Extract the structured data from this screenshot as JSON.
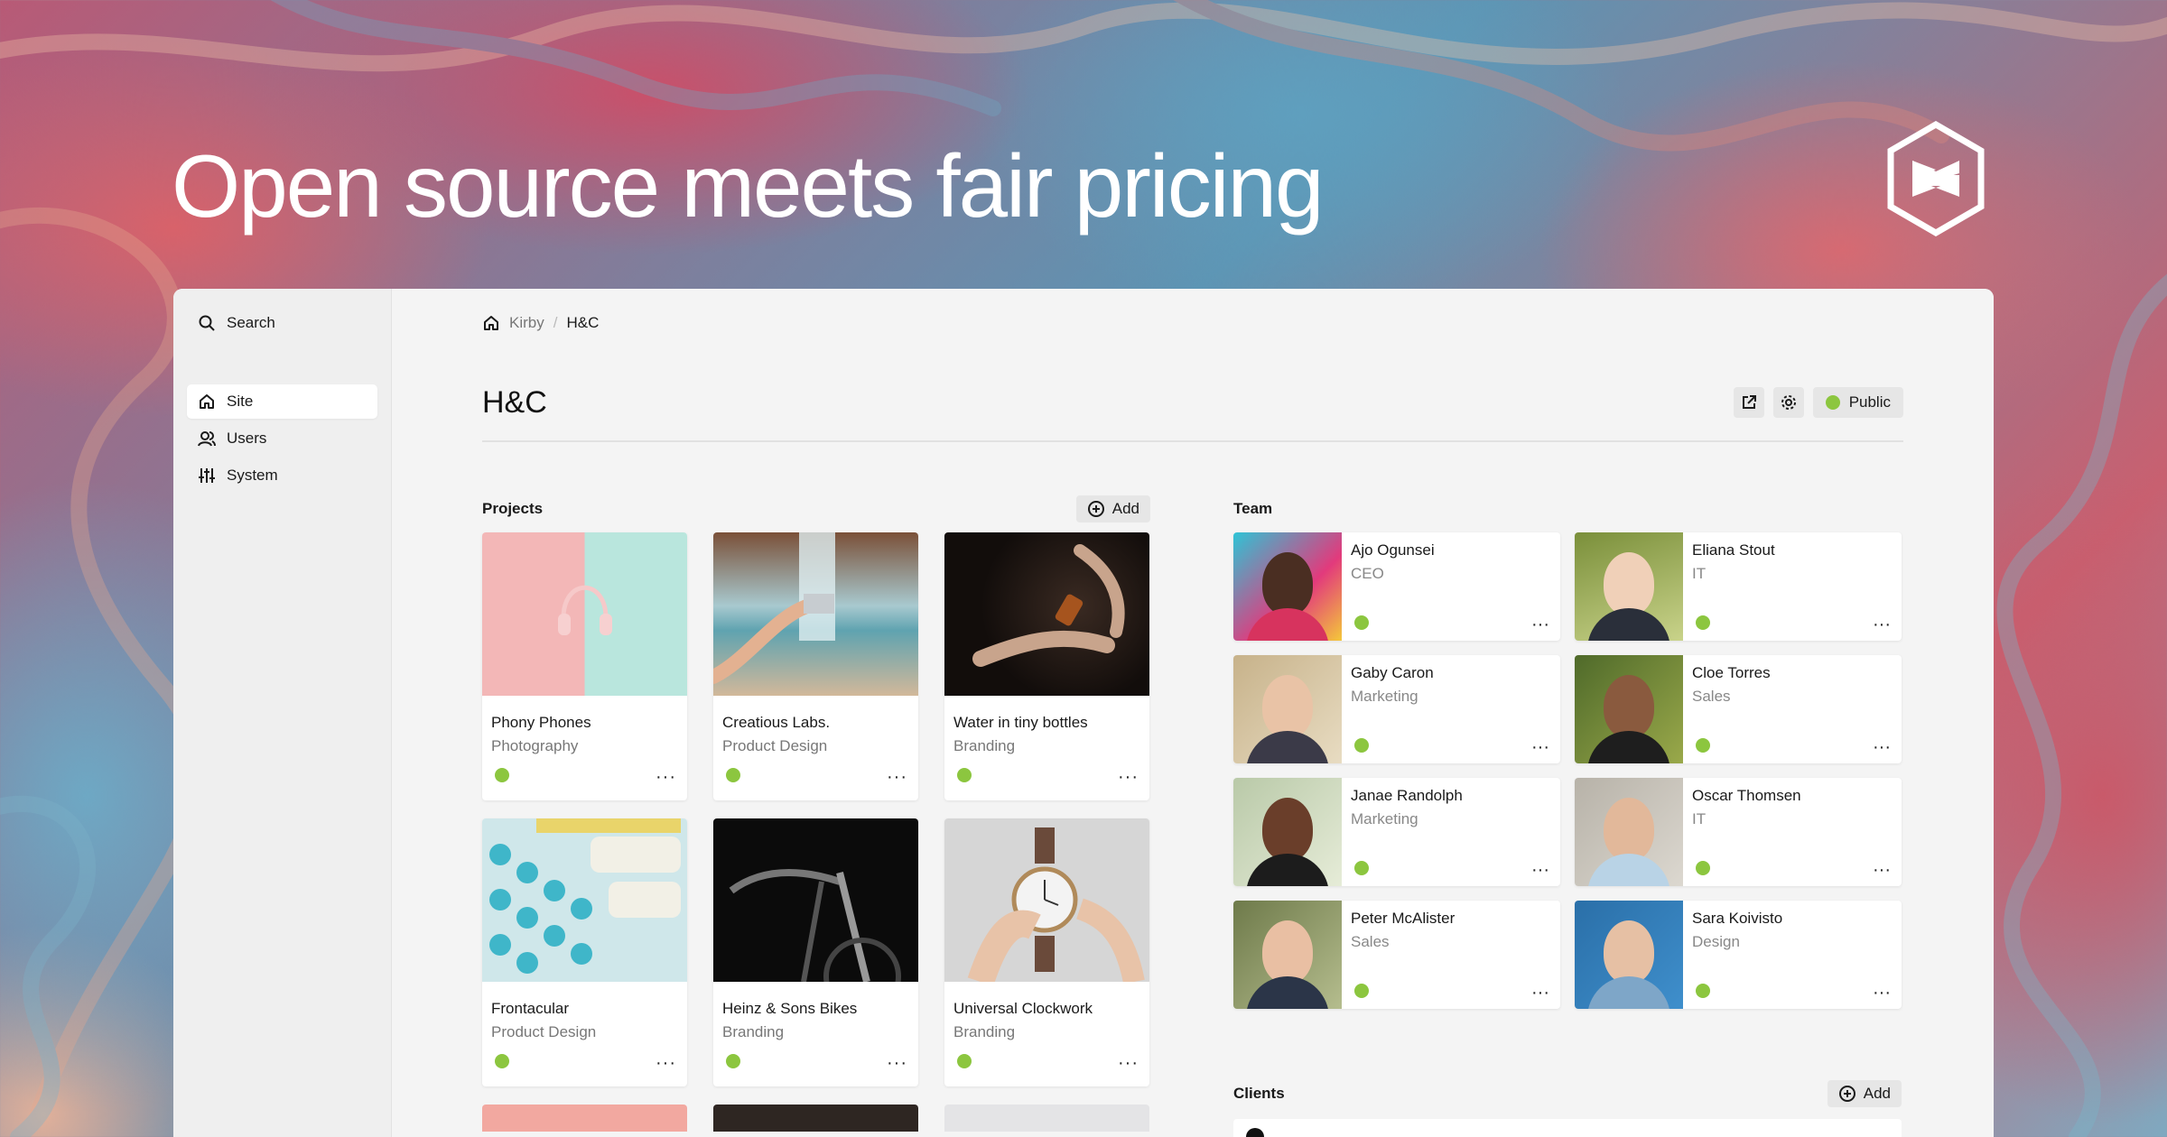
{
  "hero": {
    "title": "Open source meets fair pricing"
  },
  "sidebar": {
    "search_label": "Search",
    "items": [
      {
        "label": "Site",
        "icon": "home-icon",
        "active": true
      },
      {
        "label": "Users",
        "icon": "users-icon",
        "active": false
      },
      {
        "label": "System",
        "icon": "sliders-icon",
        "active": false
      }
    ]
  },
  "breadcrumb": {
    "root": "Kirby",
    "current": "H&C"
  },
  "page": {
    "title": "H&C",
    "status_label": "Public",
    "status_color": "#8cc63f"
  },
  "projects": {
    "title": "Projects",
    "add_label": "Add",
    "items": [
      {
        "title": "Phony Phones",
        "subtitle": "Photography"
      },
      {
        "title": "Creatious Labs.",
        "subtitle": "Product Design"
      },
      {
        "title": "Water in tiny bottles",
        "subtitle": "Branding"
      },
      {
        "title": "Frontacular",
        "subtitle": "Product Design"
      },
      {
        "title": "Heinz & Sons Bikes",
        "subtitle": "Branding"
      },
      {
        "title": "Universal Clockwork",
        "subtitle": "Branding"
      }
    ],
    "more_label": "···"
  },
  "team": {
    "title": "Team",
    "members": [
      {
        "name": "Ajo Ogunsei",
        "role": "CEO"
      },
      {
        "name": "Eliana Stout",
        "role": "IT"
      },
      {
        "name": "Gaby Caron",
        "role": "Marketing"
      },
      {
        "name": "Cloe Torres",
        "role": "Sales"
      },
      {
        "name": "Janae Randolph",
        "role": "Marketing"
      },
      {
        "name": "Oscar Thomsen",
        "role": "IT"
      },
      {
        "name": "Peter McAlister",
        "role": "Sales"
      },
      {
        "name": "Sara Koivisto",
        "role": "Design"
      }
    ]
  },
  "clients": {
    "title": "Clients",
    "add_label": "Add"
  }
}
